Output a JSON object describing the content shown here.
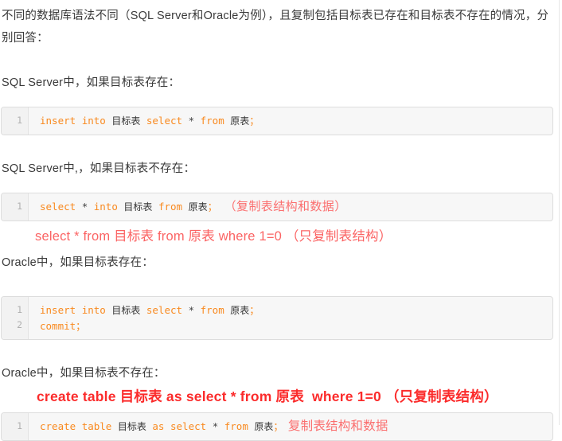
{
  "document": {
    "intro_paragraph": "不同的数据库语法不同（SQL Server和Oracle为例），且复制包括目标表已存在和目标表不存在的情况，分别回答：",
    "headings": {
      "sqlserver_exists": "SQL Server中，如果目标表存在：",
      "sqlserver_not_exists": "SQL Server中,，如果目标表不存在：",
      "oracle_exists": "Oracle中，如果目标表存在：",
      "oracle_not_exists": "Oracle中，如果目标表不存在："
    },
    "code_blocks": [
      {
        "id": "sqlserver-insert-into",
        "line_numbers": [
          "1"
        ],
        "lines": [
          {
            "tokens": [
              {
                "text": "insert",
                "type": "keyword"
              },
              {
                "text": " ",
                "type": "plain"
              },
              {
                "text": "into",
                "type": "keyword"
              },
              {
                "text": " ",
                "type": "plain"
              },
              {
                "text": "目标表",
                "type": "cjk"
              },
              {
                "text": " ",
                "type": "plain"
              },
              {
                "text": "select",
                "type": "keyword"
              },
              {
                "text": " ",
                "type": "plain"
              },
              {
                "text": "*",
                "type": "operator"
              },
              {
                "text": " ",
                "type": "plain"
              },
              {
                "text": "from",
                "type": "keyword"
              },
              {
                "text": " ",
                "type": "plain"
              },
              {
                "text": "原表",
                "type": "cjk"
              },
              {
                "text": "；",
                "type": "punctuation"
              }
            ]
          }
        ],
        "plain_text": "insert into 目标表 select * from 原表；"
      },
      {
        "id": "sqlserver-select-into",
        "line_numbers": [
          "1"
        ],
        "lines": [
          {
            "tokens": [
              {
                "text": "select",
                "type": "keyword"
              },
              {
                "text": " ",
                "type": "plain"
              },
              {
                "text": "*",
                "type": "operator"
              },
              {
                "text": " ",
                "type": "plain"
              },
              {
                "text": "into",
                "type": "keyword"
              },
              {
                "text": " ",
                "type": "plain"
              },
              {
                "text": "目标表",
                "type": "cjk"
              },
              {
                "text": " ",
                "type": "plain"
              },
              {
                "text": "from",
                "type": "keyword"
              },
              {
                "text": " ",
                "type": "plain"
              },
              {
                "text": "原表",
                "type": "cjk"
              },
              {
                "text": "；",
                "type": "punctuation"
              }
            ],
            "annotation": "（复制表结构和数据）"
          }
        ],
        "plain_text": "select * into 目标表 from 原表；"
      },
      {
        "id": "oracle-insert-into-commit",
        "line_numbers": [
          "1",
          "2"
        ],
        "lines": [
          {
            "tokens": [
              {
                "text": "insert",
                "type": "keyword"
              },
              {
                "text": " ",
                "type": "plain"
              },
              {
                "text": "into",
                "type": "keyword"
              },
              {
                "text": " ",
                "type": "plain"
              },
              {
                "text": "目标表",
                "type": "cjk"
              },
              {
                "text": " ",
                "type": "plain"
              },
              {
                "text": "select",
                "type": "keyword"
              },
              {
                "text": " ",
                "type": "plain"
              },
              {
                "text": "*",
                "type": "operator"
              },
              {
                "text": " ",
                "type": "plain"
              },
              {
                "text": "from",
                "type": "keyword"
              },
              {
                "text": " ",
                "type": "plain"
              },
              {
                "text": "原表",
                "type": "cjk"
              },
              {
                "text": "；",
                "type": "punctuation"
              }
            ]
          },
          {
            "tokens": [
              {
                "text": "commit",
                "type": "keyword"
              },
              {
                "text": "；",
                "type": "punctuation"
              }
            ]
          }
        ],
        "plain_text": "insert into 目标表 select * from 原表；\ncommit；"
      },
      {
        "id": "oracle-create-table",
        "line_numbers": [
          "1"
        ],
        "lines": [
          {
            "tokens": [
              {
                "text": "create",
                "type": "keyword"
              },
              {
                "text": " ",
                "type": "plain"
              },
              {
                "text": "table",
                "type": "keyword"
              },
              {
                "text": " ",
                "type": "plain"
              },
              {
                "text": "目标表",
                "type": "cjk"
              },
              {
                "text": " ",
                "type": "plain"
              },
              {
                "text": "as",
                "type": "keyword"
              },
              {
                "text": " ",
                "type": "plain"
              },
              {
                "text": "select",
                "type": "keyword"
              },
              {
                "text": " ",
                "type": "plain"
              },
              {
                "text": "*",
                "type": "operator"
              },
              {
                "text": " ",
                "type": "plain"
              },
              {
                "text": "from",
                "type": "keyword"
              },
              {
                "text": " ",
                "type": "plain"
              },
              {
                "text": "原表",
                "type": "cjk"
              },
              {
                "text": "；",
                "type": "punctuation"
              }
            ],
            "annotation": "复制表结构和数据"
          }
        ],
        "plain_text": "create table 目标表 as select * from 原表；"
      }
    ],
    "annotations": {
      "sqlserver_copy_structure_and_data": "（复制表结构和数据）",
      "sqlserver_copy_structure_only": "select * from 目标表 from 原表 where 1=0 （只复制表结构）",
      "oracle_copy_structure_only": "create table 目标表 as select * from 原表  where 1=0 （只复制表结构）",
      "oracle_copy_structure_and_data": "复制表结构和数据"
    },
    "colors": {
      "keyword": "#f98a20",
      "code_text": "#333333",
      "annotation_soft_red": "#fb6f6f",
      "annotation_strong_red": "#fb2b2b",
      "body_text": "#3a3a3a",
      "code_background": "#f7f7f7",
      "gutter_background": "#f2f2f2",
      "code_border": "#dddddd",
      "line_number": "#b0b0b0"
    }
  }
}
